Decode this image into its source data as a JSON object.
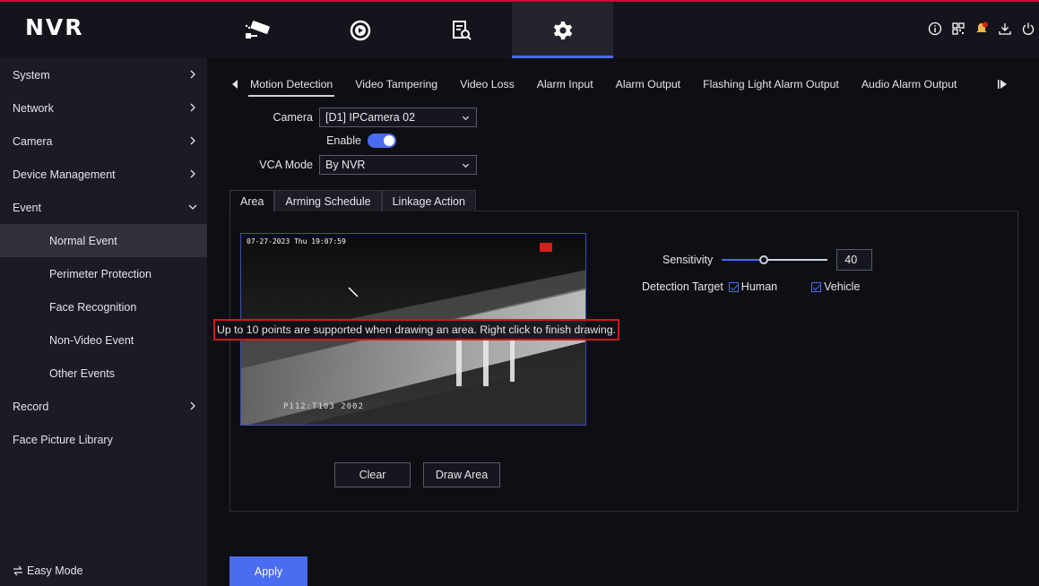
{
  "app": {
    "logo": "NVR"
  },
  "topnav": [
    {
      "name": "live-view-icon"
    },
    {
      "name": "playback-icon"
    },
    {
      "name": "search-file-icon"
    },
    {
      "name": "settings-gear-icon"
    }
  ],
  "topright_icons": [
    "info-icon",
    "qr-code-icon",
    "alarm-bell-icon",
    "download-icon",
    "power-icon"
  ],
  "sidebar": {
    "items": [
      {
        "label": "System"
      },
      {
        "label": "Network"
      },
      {
        "label": "Camera"
      },
      {
        "label": "Device Management"
      },
      {
        "label": "Event"
      },
      {
        "label": "Normal Event"
      },
      {
        "label": "Perimeter Protection"
      },
      {
        "label": "Face Recognition"
      },
      {
        "label": "Non-Video Event"
      },
      {
        "label": "Other Events"
      },
      {
        "label": "Record"
      },
      {
        "label": "Face Picture Library"
      }
    ],
    "easy_mode": "Easy Mode"
  },
  "tabs": [
    "Motion Detection",
    "Video Tampering",
    "Video Loss",
    "Alarm Input",
    "Alarm Output",
    "Flashing Light Alarm Output",
    "Audio Alarm Output"
  ],
  "form": {
    "camera_label": "Camera",
    "camera_value": "[D1] IPCamera 02",
    "enable_label": "Enable",
    "vca_label": "VCA Mode",
    "vca_value": "By NVR"
  },
  "subtabs": [
    "Area",
    "Arming Schedule",
    "Linkage Action"
  ],
  "video": {
    "osd_time": "07-27-2023 Thu 19:07:59",
    "osd_bottom": "P112:T103 2002"
  },
  "hint": "Up to 10 points are supported when drawing an area. Right click to finish drawing.",
  "sensitivity": {
    "label": "Sensitivity",
    "value": "40",
    "level": 40
  },
  "detection": {
    "label": "Detection Target",
    "human": "Human",
    "vehicle": "Vehicle"
  },
  "buttons": {
    "clear": "Clear",
    "draw_area": "Draw Area",
    "apply": "Apply"
  },
  "colors": {
    "accent": "#4a6cf0",
    "alert_border": "#d01a1a"
  }
}
